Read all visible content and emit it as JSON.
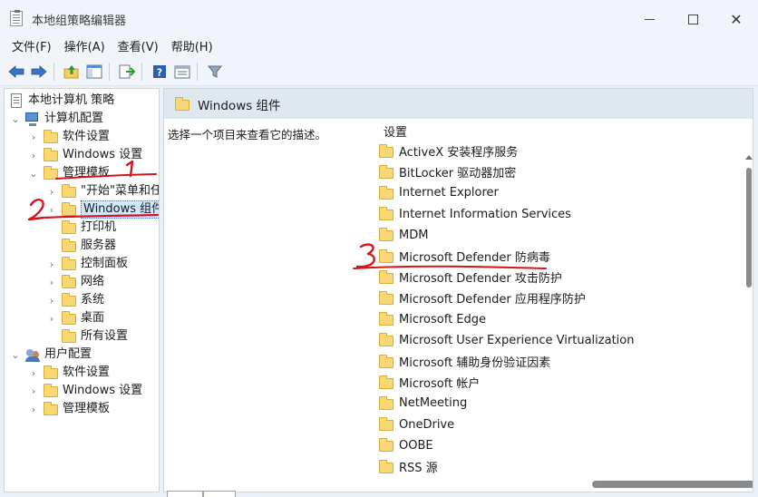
{
  "window": {
    "title": "本地组策略编辑器"
  },
  "menu": [
    "文件(F)",
    "操作(A)",
    "查看(V)",
    "帮助(H)"
  ],
  "toolbar": {
    "icons": [
      "back-arrow-icon",
      "forward-arrow-icon",
      "up-folder-icon",
      "show-tree-icon",
      "export-list-icon",
      "help-icon",
      "properties-icon",
      "filter-icon"
    ]
  },
  "tree": {
    "root": "本地计算机 策略",
    "computer_config": "计算机配置",
    "cc_software": "软件设置",
    "cc_windows": "Windows 设置",
    "cc_admin": "管理模板",
    "at_start": "\"开始\"菜单和任",
    "at_windows_components": "Windows 组件",
    "at_printers": "打印机",
    "at_servers": "服务器",
    "at_control_panel": "控制面板",
    "at_network": "网络",
    "at_system": "系统",
    "at_desktop": "桌面",
    "at_all_settings": "所有设置",
    "user_config": "用户配置",
    "uc_software": "软件设置",
    "uc_windows": "Windows 设置",
    "uc_admin": "管理模板"
  },
  "content": {
    "header": "Windows 组件",
    "description": "选择一个项目来查看它的描述。",
    "column_header": "设置",
    "items": [
      "ActiveX 安装程序服务",
      "BitLocker 驱动器加密",
      "Internet Explorer",
      "Internet Information Services",
      "MDM",
      "Microsoft Defender 防病毒",
      "Microsoft Defender 攻击防护",
      "Microsoft Defender 应用程序防护",
      "Microsoft Edge",
      "Microsoft User Experience Virtualization",
      "Microsoft 辅助身份验证因素",
      "Microsoft 帐户",
      "NetMeeting",
      "OneDrive",
      "OOBE",
      "RSS 源"
    ]
  },
  "annotations": {
    "marks": [
      "1",
      "2",
      "3"
    ],
    "color": "#d4141c"
  },
  "colors": {
    "folder": "#f8d775",
    "selection": "#cde8ff",
    "header_bg": "#dfe7ef"
  }
}
